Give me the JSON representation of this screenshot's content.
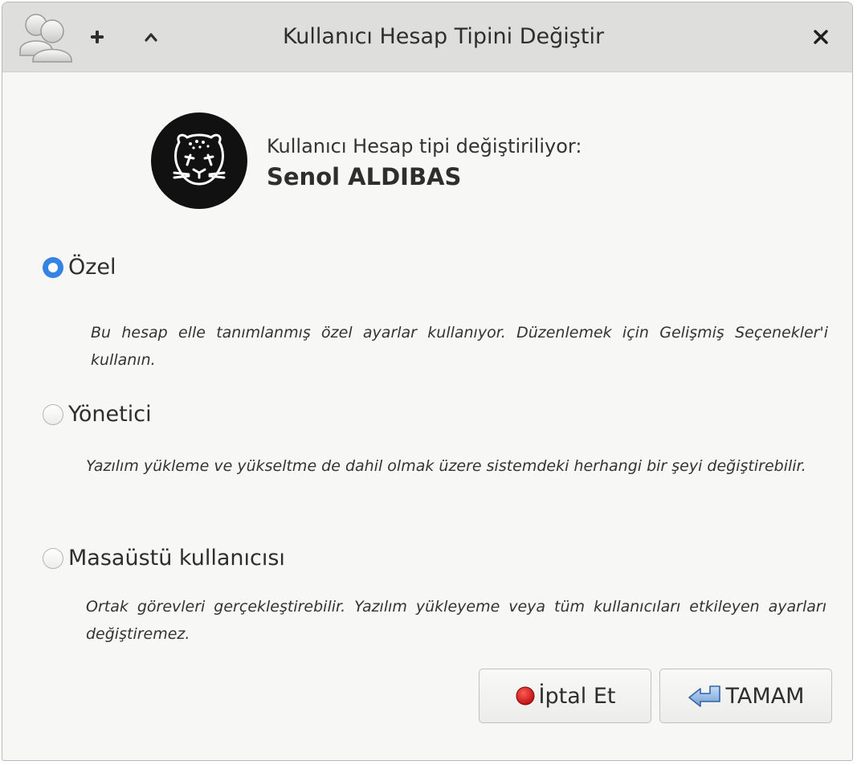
{
  "window": {
    "title": "Kullanıcı Hesap Tipini Değiştir",
    "add_glyph": "+",
    "up_glyph": "^",
    "close_glyph": "×"
  },
  "header": {
    "subtitle": "Kullanıcı Hesap tipi değiştiriliyor:",
    "user_name": "Senol ALDIBAS"
  },
  "options": [
    {
      "label": "Özel",
      "checked": true,
      "description": "Bu hesap elle tanımlanmış özel ayarlar kullanıyor. Düzenlemek için Gelişmiş Seçenekler'i kullanın."
    },
    {
      "label": "Yönetici",
      "checked": false,
      "description": "Yazılım yükleme ve yükseltme de dahil olmak üzere sistemdeki herhangi bir şeyi değiştirebilir."
    },
    {
      "label": "Masaüstü kullanıcısı",
      "checked": false,
      "description": "Ortak görevleri gerçekleştirebilir. Yazılım yükleyeme veya tüm kullanıcıları etkileyen ayarları değiştiremez."
    }
  ],
  "buttons": {
    "cancel_label": "İptal Et",
    "ok_label": "TAMAM"
  },
  "colors": {
    "accent": "#3584e4",
    "titlebar": "#dededc",
    "stop_red": "#d8151b"
  }
}
